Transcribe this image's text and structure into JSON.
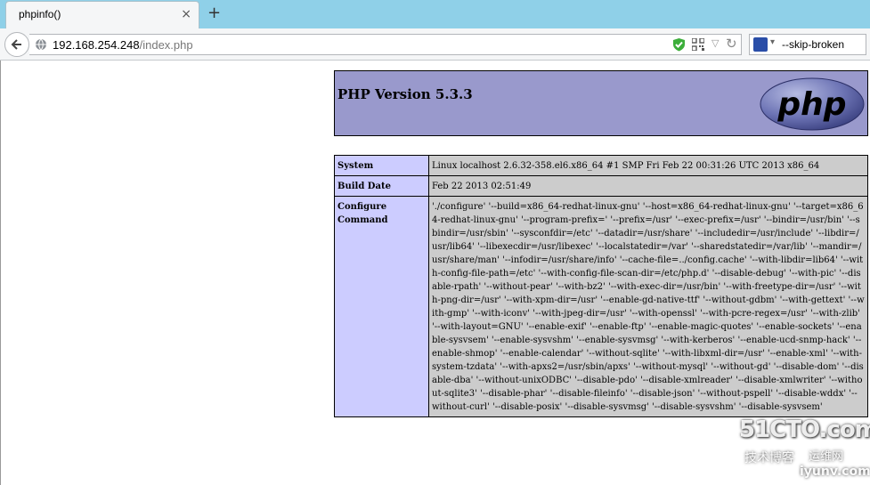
{
  "browser": {
    "tab_title": "phpinfo()",
    "tab_close": "×",
    "new_tab": "+",
    "url_host": "192.168.254.248",
    "url_path": "/index.php",
    "search_text": "--skip-broken",
    "icons": [
      "back-arrow-icon",
      "globe-icon",
      "shield-icon",
      "qr-code-icon",
      "dropdown-arrow-icon",
      "reload-icon",
      "search-engine-icon"
    ]
  },
  "phpinfo": {
    "version": "PHP Version 5.3.3",
    "logo_text": "php",
    "rows": [
      {
        "label": "System",
        "value": "Linux localhost 2.6.32-358.el6.x86_64 #1 SMP Fri Feb 22 00:31:26 UTC 2013 x86_64"
      },
      {
        "label": "Build Date",
        "value": "Feb 22 2013 02:51:49"
      },
      {
        "label": "Configure Command",
        "value": "'./configure' '--build=x86_64-redhat-linux-gnu' '--host=x86_64-redhat-linux-gnu' '--target=x86_64-redhat-linux-gnu' '--program-prefix=' '--prefix=/usr' '--exec-prefix=/usr' '--bindir=/usr/bin' '--sbindir=/usr/sbin' '--sysconfdir=/etc' '--datadir=/usr/share' '--includedir=/usr/include' '--libdir=/usr/lib64' '--libexecdir=/usr/libexec' '--localstatedir=/var' '--sharedstatedir=/var/lib' '--mandir=/usr/share/man' '--infodir=/usr/share/info' '--cache-file=../config.cache' '--with-libdir=lib64' '--with-config-file-path=/etc' '--with-config-file-scan-dir=/etc/php.d' '--disable-debug' '--with-pic' '--disable-rpath' '--without-pear' '--with-bz2' '--with-exec-dir=/usr/bin' '--with-freetype-dir=/usr' '--with-png-dir=/usr' '--with-xpm-dir=/usr' '--enable-gd-native-ttf' '--without-gdbm' '--with-gettext' '--with-gmp' '--with-iconv' '--with-jpeg-dir=/usr' '--with-openssl' '--with-pcre-regex=/usr' '--with-zlib' '--with-layout=GNU' '--enable-exif' '--enable-ftp' '--enable-magic-quotes' '--enable-sockets' '--enable-sysvsem' '--enable-sysvshm' '--enable-sysvmsg' '--with-kerberos' '--enable-ucd-snmp-hack' '--enable-shmop' '--enable-calendar' '--without-sqlite' '--with-libxml-dir=/usr' '--enable-xml' '--with-system-tzdata' '--with-apxs2=/usr/sbin/apxs' '--without-mysql' '--without-gd' '--disable-dom' '--disable-dba' '--without-unixODBC' '--disable-pdo' '--disable-xmlreader' '--disable-xmlwriter' '--without-sqlite3' '--disable-phar' '--disable-fileinfo' '--disable-json' '--without-pspell' '--disable-wddx' '--without-curl' '--disable-posix' '--disable-sysvmsg' '--disable-sysvshm' '--disable-sysvsem'"
      }
    ]
  },
  "watermark": {
    "line1": "51CTO.com",
    "line2": "技术博客",
    "line3": "运维网",
    "line4": "iyunv.com"
  }
}
